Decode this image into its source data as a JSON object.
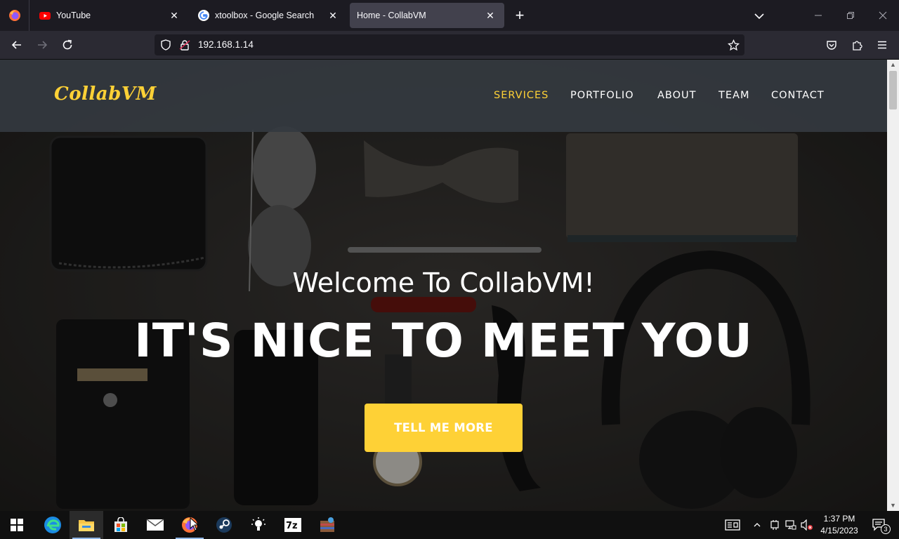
{
  "browser": {
    "tabs": [
      {
        "label": "YouTube",
        "close": "✕"
      },
      {
        "label": "xtoolbox - Google Search",
        "close": "✕"
      },
      {
        "label": "Home - CollabVM",
        "close": "✕"
      }
    ],
    "new_tab": "+",
    "url": "192.168.1.14"
  },
  "site": {
    "brand": "CollabVM",
    "nav": [
      {
        "label": "SERVICES"
      },
      {
        "label": "PORTFOLIO"
      },
      {
        "label": "ABOUT"
      },
      {
        "label": "TEAM"
      },
      {
        "label": "CONTACT"
      }
    ],
    "hero": {
      "welcome": "Welcome To CollabVM!",
      "headline": "IT'S NICE TO MEET YOU",
      "cta": "TELL ME MORE"
    },
    "accent_color": "#fed136"
  },
  "taskbar": {
    "apps": [
      "windows-start",
      "edge",
      "file-explorer",
      "microsoft-store",
      "mail",
      "firefox",
      "steam",
      "tips",
      "7-zip",
      "winrar"
    ],
    "clock": {
      "time": "1:37 PM",
      "date": "4/15/2023"
    },
    "notification_count": "3"
  }
}
